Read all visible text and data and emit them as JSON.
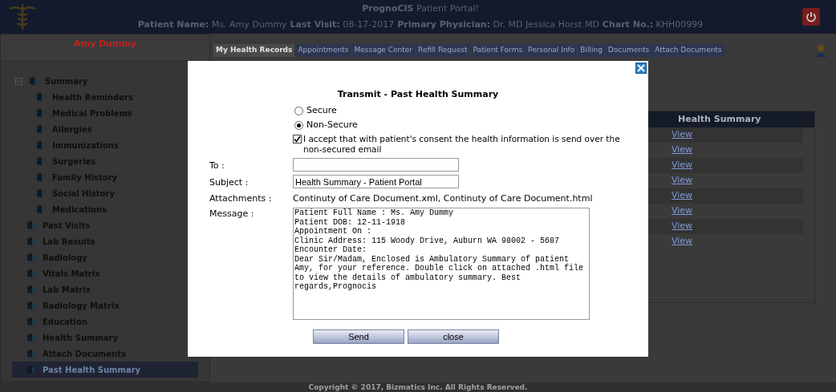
{
  "header": {
    "brand": "PrognoCIS",
    "title": "Patient Portal!",
    "facts": [
      {
        "label": "Patient Name:",
        "value": "Ms. Amy Dummy"
      },
      {
        "label": "Last Visit:",
        "value": "08-17-2017"
      },
      {
        "label": "Primary Physician:",
        "value": "Dr. MD Jessica Horst MD"
      },
      {
        "label": "Chart No.:",
        "value": "KHH00999"
      }
    ]
  },
  "sidebar": {
    "patient_name": "Amy Dummy",
    "items": [
      {
        "label": "Summary",
        "selected": false,
        "expanded": true,
        "children": [
          {
            "label": "Health Reminders",
            "selected": false
          },
          {
            "label": "Medical Problems",
            "selected": false
          },
          {
            "label": "Allergies",
            "selected": false
          },
          {
            "label": "Immunizations",
            "selected": false
          },
          {
            "label": "Surgeries",
            "selected": false
          },
          {
            "label": "Family History",
            "selected": false
          },
          {
            "label": "Social History",
            "selected": false
          },
          {
            "label": "Medications",
            "selected": false
          }
        ]
      },
      {
        "label": "Past Visits",
        "selected": false
      },
      {
        "label": "Lab Results",
        "selected": false
      },
      {
        "label": "Radiology",
        "selected": false
      },
      {
        "label": "Vitals Matrix",
        "selected": false
      },
      {
        "label": "Lab Matrix",
        "selected": false
      },
      {
        "label": "Radiology Matrix",
        "selected": false
      },
      {
        "label": "Education",
        "selected": false
      },
      {
        "label": "Health Summary",
        "selected": false
      },
      {
        "label": "Attach Documents",
        "selected": false
      },
      {
        "label": "Past Health Summary",
        "selected": true
      }
    ]
  },
  "tabs": [
    {
      "label": "My Health Records",
      "selected": true
    },
    {
      "label": "Appointments",
      "selected": false
    },
    {
      "label": "Message Center",
      "selected": false
    },
    {
      "label": "Refill Request",
      "selected": false
    },
    {
      "label": "Patient Forms",
      "selected": false
    },
    {
      "label": "Personal Info",
      "selected": false
    },
    {
      "label": "Billing",
      "selected": false
    },
    {
      "label": "Documents",
      "selected": false
    },
    {
      "label": "Attach Documents",
      "selected": false
    }
  ],
  "table": {
    "columns": [
      "Health Summary"
    ],
    "rows": [
      "View",
      "View",
      "View",
      "View",
      "View",
      "View",
      "View",
      "View"
    ]
  },
  "footer": "Copyright © 2017, Bizmatics Inc. All Rights Reserved.",
  "dialog": {
    "title": "Transmit - Past Health Summary",
    "security": [
      {
        "label": "Secure",
        "selected": false
      },
      {
        "label": "Non-Secure",
        "selected": true
      }
    ],
    "consent": {
      "checked": true,
      "text": "I accept that with patient's consent the health information is send over the non-secured email"
    },
    "to": {
      "label": "To :"
    },
    "subject": {
      "label": "Subject :",
      "value": "Health Summary - Patient Portal"
    },
    "attachments": {
      "label": "Attachments :",
      "value": "Continuty of Care Document.xml, Continuty of Care Document.html"
    },
    "message": {
      "label": "Message :",
      "value": "Patient Full Name : Ms. Amy Dummy\nPatient DOB: 12-11-1918\nAppointment On :\nClinic Address: 115 Woody Drive, Auburn WA 98002 - 5687\nEncounter Date:\nDear Sir/Madam, Enclosed is Ambulatory Summary of patient Amy, for your reference. Double click on attached .html file to view the details of ambulatory summary. Best regards,Prognocis"
    },
    "buttons": [
      "Send",
      "close"
    ]
  }
}
